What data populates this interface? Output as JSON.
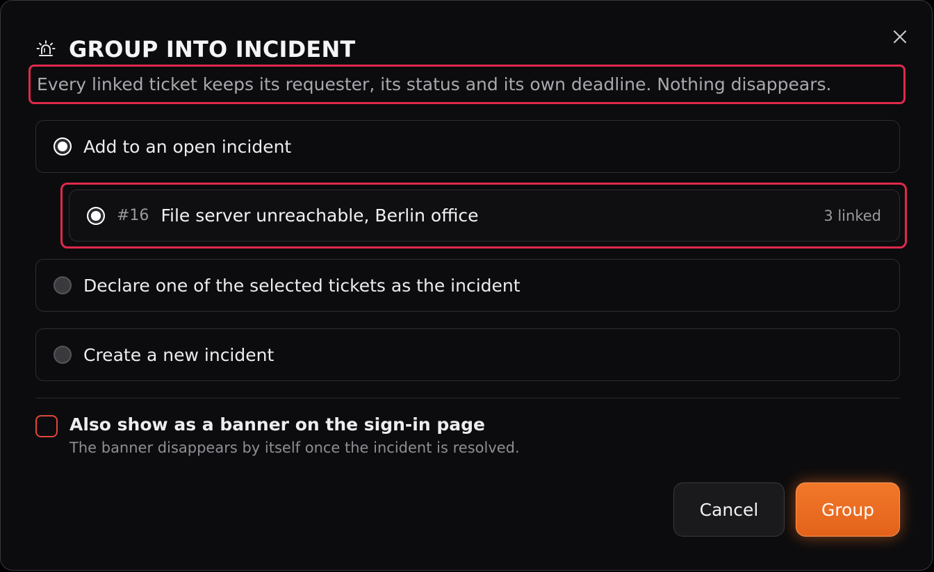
{
  "dialog": {
    "title": "GROUP INTO INCIDENT",
    "subtitle": "Every linked ticket keeps its requester, its status and its own deadline. Nothing disappears.",
    "title_icon": "siren-icon",
    "close_icon": "close-icon"
  },
  "options": {
    "add_existing": {
      "label": "Add to an open incident",
      "selected": true
    },
    "declare": {
      "label": "Declare one of the selected tickets as the incident",
      "selected": false
    },
    "create_new": {
      "label": "Create a new incident",
      "selected": false
    }
  },
  "open_incident": {
    "number": "#16",
    "name": "File server unreachable, Berlin office",
    "linked": "3 linked",
    "selected": true
  },
  "banner_option": {
    "label": "Also show as a banner on the sign-in page",
    "help": "The banner disappears by itself once the incident is resolved.",
    "checked": false
  },
  "buttons": {
    "cancel": "Cancel",
    "group": "Group"
  },
  "colors": {
    "accent": "#f0702a",
    "highlight": "#e0294b",
    "checkbox_border": "#e0473a",
    "background": "#0c0c0e"
  }
}
